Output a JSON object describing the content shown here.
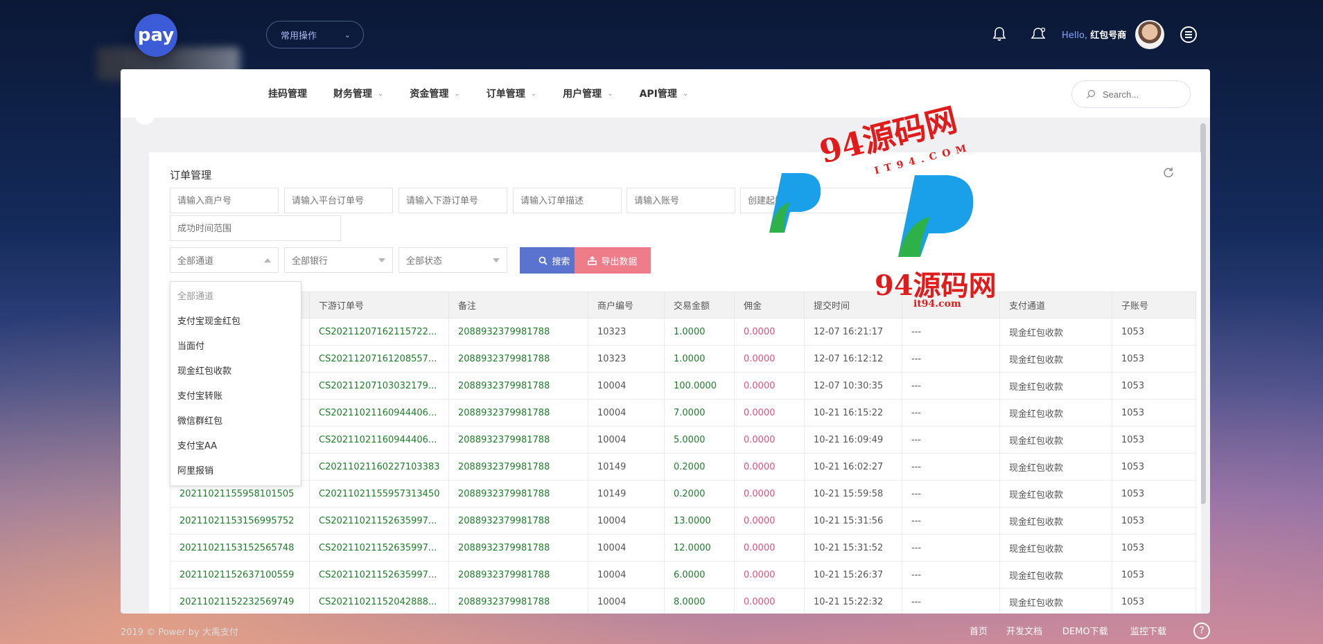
{
  "brand": {
    "logo_text": "pay"
  },
  "header": {
    "quick_ops": "常用操作",
    "hello": "Hello,",
    "username": "红包号商"
  },
  "nav": {
    "items": [
      {
        "label": "挂码管理",
        "dropdown": false
      },
      {
        "label": "财务管理",
        "dropdown": true
      },
      {
        "label": "资金管理",
        "dropdown": true
      },
      {
        "label": "订单管理",
        "dropdown": true
      },
      {
        "label": "用户管理",
        "dropdown": true
      },
      {
        "label": "API管理",
        "dropdown": true
      }
    ],
    "search_placeholder": "Search..."
  },
  "panel": {
    "title": "订单管理",
    "filters": {
      "merchant_no": "请输入商户号",
      "platform_order": "请输入平台订单号",
      "downstream_order": "请输入下游订单号",
      "order_desc": "请输入订单描述",
      "account": "请输入账号",
      "create_time": "创建起始时间",
      "success_range": "成功时间范围",
      "channel": "全部通道",
      "bank": "全部银行",
      "status": "全部状态"
    },
    "search_button": "搜索",
    "export_button": "导出数据"
  },
  "channel_dropdown": [
    "全部通道",
    "支付宝现金红包",
    "当面付",
    "现金红包收款",
    "支付宝转账",
    "微信群红包",
    "支付宝AA",
    "阿里报销"
  ],
  "table": {
    "columns": [
      "",
      "下游订单号",
      "备注",
      "商户编号",
      "交易金额",
      "佣金",
      "提交时间",
      "",
      "支付通道",
      "子账号"
    ],
    "rows": [
      [
        "",
        "CS20211207162115722...",
        "2088932379981788",
        "10323",
        "1.0000",
        "0.0000",
        "12-07 16:21:17",
        "---",
        "现金红包收款",
        "1053"
      ],
      [
        "",
        "CS20211207161208557...",
        "2088932379981788",
        "10323",
        "1.0000",
        "0.0000",
        "12-07 16:12:12",
        "---",
        "现金红包收款",
        "1053"
      ],
      [
        "",
        "CS20211207103032179...",
        "2088932379981788",
        "10004",
        "100.0000",
        "0.0000",
        "12-07 10:30:35",
        "---",
        "现金红包收款",
        "1053"
      ],
      [
        "",
        "CS20211021160944406...",
        "2088932379981788",
        "10004",
        "7.0000",
        "0.0000",
        "10-21 16:15:22",
        "---",
        "现金红包收款",
        "1053"
      ],
      [
        "",
        "CS20211021160944406...",
        "2088932379981788",
        "10004",
        "5.0000",
        "0.0000",
        "10-21 16:09:49",
        "---",
        "现金红包收款",
        "1053"
      ],
      [
        "",
        "C20211021160227103383",
        "2088932379981788",
        "10149",
        "0.2000",
        "0.0000",
        "10-21 16:02:27",
        "---",
        "现金红包收款",
        "1053"
      ],
      [
        "20211021155958101505",
        "C20211021155957313450",
        "2088932379981788",
        "10149",
        "0.2000",
        "0.0000",
        "10-21 15:59:58",
        "---",
        "现金红包收款",
        "1053"
      ],
      [
        "20211021153156995752",
        "CS20211021152635997...",
        "2088932379981788",
        "10004",
        "13.0000",
        "0.0000",
        "10-21 15:31:56",
        "---",
        "现金红包收款",
        "1053"
      ],
      [
        "20211021153152565748",
        "CS20211021152635997...",
        "2088932379981788",
        "10004",
        "12.0000",
        "0.0000",
        "10-21 15:31:52",
        "---",
        "现金红包收款",
        "1053"
      ],
      [
        "20211021152637100559",
        "CS20211021152635997...",
        "2088932379981788",
        "10004",
        "6.0000",
        "0.0000",
        "10-21 15:26:37",
        "---",
        "现金红包收款",
        "1053"
      ],
      [
        "20211021152232569749",
        "CS20211021152042888...",
        "2088932379981788",
        "10004",
        "8.0000",
        "0.0000",
        "10-21 15:22:32",
        "---",
        "现金红包收款",
        "1053"
      ]
    ]
  },
  "watermark": {
    "top": "94源码网",
    "top_sub": "IT94.COM",
    "mid": "94源码网",
    "mid_sub": "it94.com"
  },
  "footer": {
    "copyright": "2019 © Power by",
    "company": "大禹支付",
    "links": [
      "首页",
      "开发文档",
      "DEMO下载",
      "监控下载"
    ],
    "help": "?"
  }
}
